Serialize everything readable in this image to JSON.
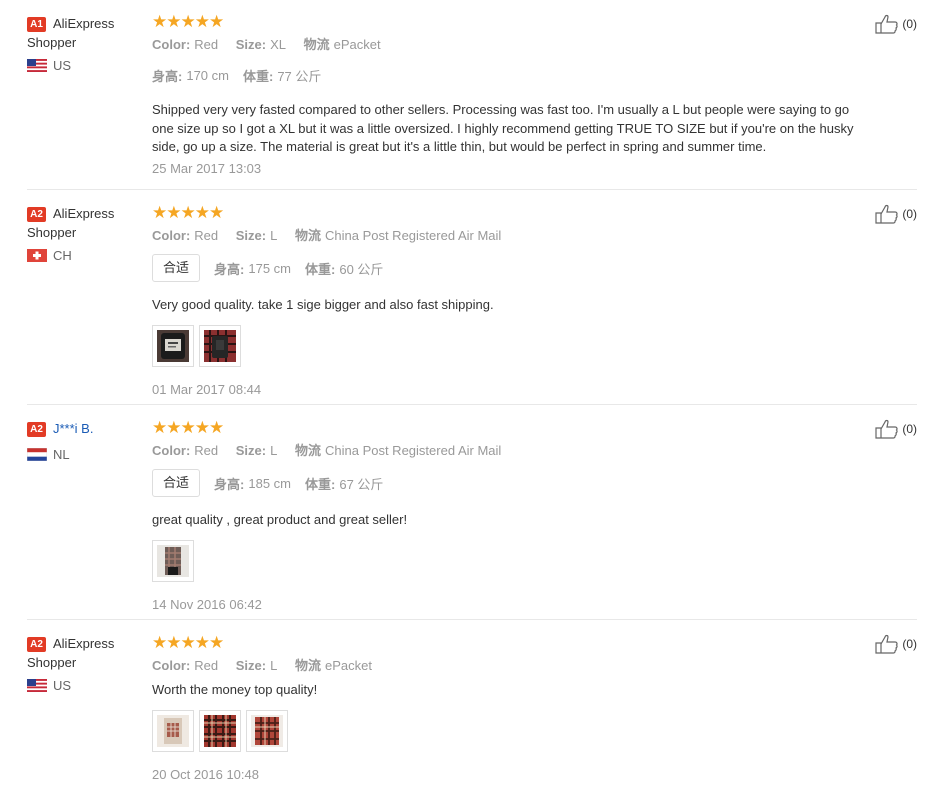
{
  "reviews": [
    {
      "badge": "A1",
      "name_line1": "AliExpress",
      "name_line2": "Shopper",
      "country": "US",
      "flag": "us",
      "stars": "★★★★★",
      "color_label": "Color:",
      "color_value": "Red",
      "size_label": "Size:",
      "size_value": "XL",
      "ship_label": "物流",
      "ship_value": "ePacket",
      "fit": "",
      "height_label": "身高:",
      "height_value": "170 cm",
      "weight_label": "体重:",
      "weight_value": "77 公斤",
      "text": "Shipped very very fasted compared to other sellers. Processing was fast too. I'm usually a L but people were saying to go one size up so I got a XL but it was a little oversized. I highly recommend getting TRUE TO SIZE but if you're on the husky side, go up a size. The material is great but it's a little thin, but would be perfect in spring and summer time.",
      "date": "25 Mar 2017 13:03",
      "likes": "(0)",
      "photos": []
    },
    {
      "badge": "A2",
      "name_line1": "AliExpress",
      "name_line2": "Shopper",
      "country": "CH",
      "flag": "ch",
      "stars": "★★★★★",
      "color_label": "Color:",
      "color_value": "Red",
      "size_label": "Size:",
      "size_value": "L",
      "ship_label": "物流",
      "ship_value": "China Post Registered Air Mail",
      "fit": "合适",
      "height_label": "身高:",
      "height_value": "175 cm",
      "weight_label": "体重:",
      "weight_value": "60 公斤",
      "text": "Very good quality. take 1 sige bigger and also fast shipping.",
      "date": "01 Mar 2017 08:44",
      "likes": "(0)",
      "photos": [
        "black-shirt-photo",
        "plaid-shirt-photo"
      ]
    },
    {
      "badge": "A2",
      "name_line1": "J***i B.",
      "name_line2": "",
      "country": "NL",
      "flag": "nl",
      "stars": "★★★★★",
      "color_label": "Color:",
      "color_value": "Red",
      "size_label": "Size:",
      "size_value": "L",
      "ship_label": "物流",
      "ship_value": "China Post Registered Air Mail",
      "fit": "合适",
      "height_label": "身高:",
      "height_value": "185 cm",
      "weight_label": "体重:",
      "weight_value": "67 公斤",
      "text": "great quality , great product and great seller!",
      "date": "14 Nov 2016 06:42",
      "likes": "(0)",
      "photos": [
        "mirror-selfie-photo"
      ]
    },
    {
      "badge": "A2",
      "name_line1": "AliExpress",
      "name_line2": "Shopper",
      "country": "US",
      "flag": "us",
      "stars": "★★★★★",
      "color_label": "Color:",
      "color_value": "Red",
      "size_label": "Size:",
      "size_value": "L",
      "ship_label": "物流",
      "ship_value": "ePacket",
      "fit": "",
      "height_label": "",
      "height_value": "",
      "weight_label": "",
      "weight_value": "",
      "text": "Worth the money top quality!",
      "date": "20 Oct 2016 10:48",
      "likes": "(0)",
      "photos": [
        "package-photo",
        "red-plaid-photo",
        "red-plaid-closeup-photo"
      ]
    }
  ]
}
